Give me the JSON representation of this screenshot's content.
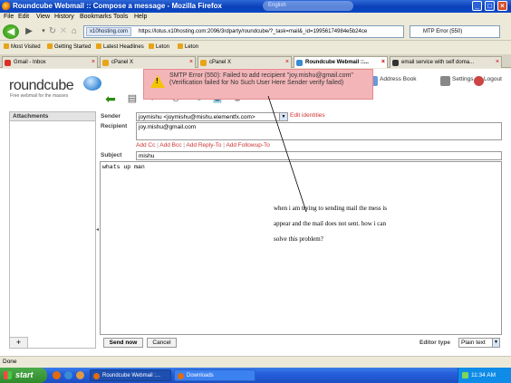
{
  "window": {
    "title": "Roundcube Webmail :: Compose a message - Mozilla Firefox",
    "title_overlay": "English"
  },
  "menu": [
    "File",
    "Edit",
    "View",
    "History",
    "Bookmarks",
    "Tools",
    "Help"
  ],
  "address": {
    "site": "x10hosting.com",
    "url": "https://lotus.x10hosting.com:2096/3rdparty/roundcube/?_task=mail&_id=19956174984e5b24ce"
  },
  "search": {
    "value": "MTP Error (550)"
  },
  "bookmarks": [
    "Most Visited",
    "Getting Started",
    "Latest Headlines",
    "Leton",
    "Leton"
  ],
  "tabs": [
    {
      "label": "Gmail - Inbox",
      "color": "#d93025"
    },
    {
      "label": "cPanel X",
      "color": "#e8a317"
    },
    {
      "label": "cPanel X",
      "color": "#e8a317"
    },
    {
      "label": "Roundcube Webmail ::...",
      "color": "#3a8ad6",
      "active": true
    },
    {
      "label": "email service with self doma...",
      "color": "#333333"
    }
  ],
  "brand": {
    "name": "roundcube",
    "tagline": "Free webmail for the masses"
  },
  "topnav": {
    "address_book": "Address Book",
    "settings": "Settings",
    "logout": "Logout"
  },
  "error": {
    "text": "SMTP Error (550): Failed to add recipient \"joy.mishu@gmail.com\" (Verification failed for No Such User Here Sender verify failed)"
  },
  "attachments": {
    "header": "Attachments",
    "add": "+"
  },
  "compose": {
    "sender_label": "Sender",
    "sender_value": "joymishu <joymishu@mishu.elementfx.com>",
    "edit_identities": "Edit identities",
    "recipient_label": "Recipient",
    "recipient_value": "joy.mishu@gmail.com",
    "add_cc": "Add Cc",
    "add_bcc": "Add Bcc",
    "add_reply_to": "Add Reply-To",
    "add_followup_to": "Add Followup-To",
    "separator": " | ",
    "subject_label": "Subject",
    "subject_value": "mishu",
    "body": "whats up man",
    "send": "Send now",
    "cancel": "Cancel",
    "editor_type_label": "Editor type",
    "editor_type_value": "Plain text"
  },
  "annotation": {
    "lines": [
      "when i am trying to sending mail the mess is",
      "appear and the mail does not sent. how i can",
      "solve this problem?"
    ]
  },
  "status": {
    "text": "Done"
  },
  "taskbar": {
    "start": "start",
    "items": [
      "Roundcube Webmail :...",
      "Downloads"
    ],
    "clock": "11:34 AM"
  }
}
